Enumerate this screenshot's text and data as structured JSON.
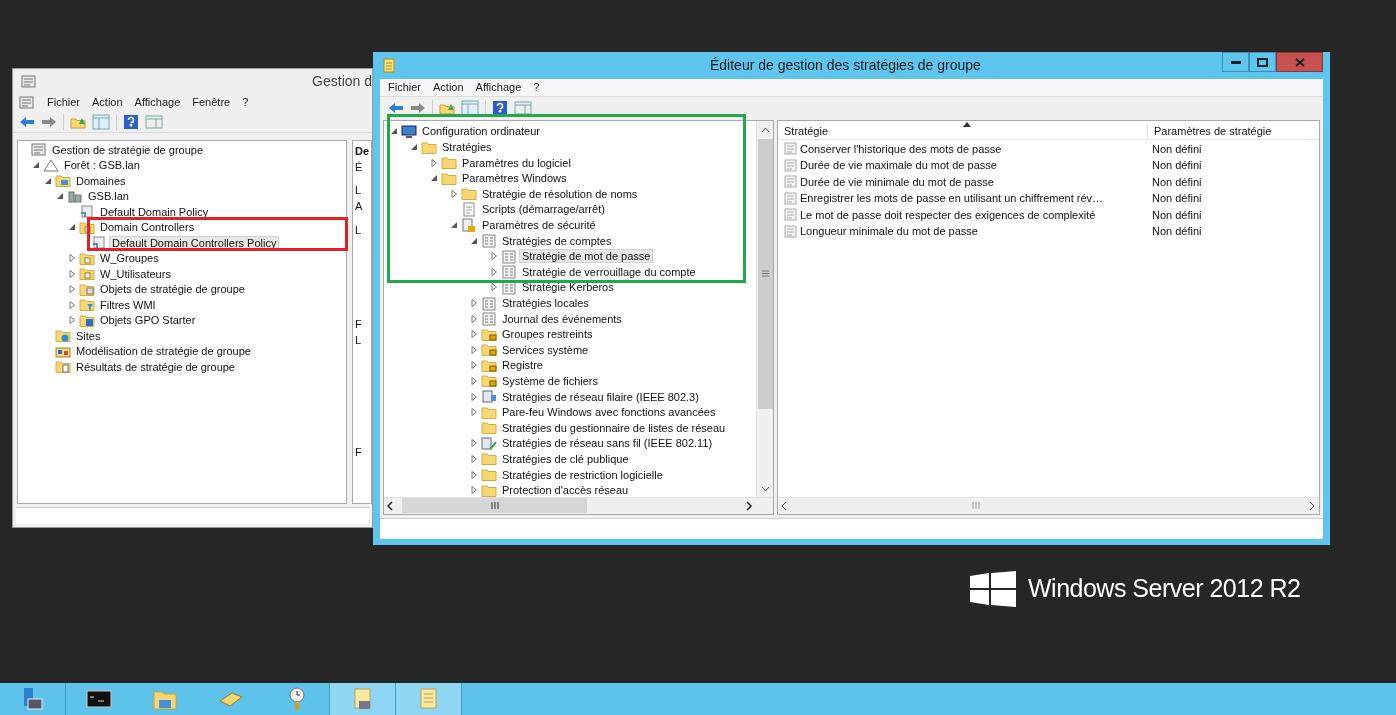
{
  "back_window": {
    "title": "Gestion d",
    "menu": [
      "Fichier",
      "Action",
      "Affichage",
      "Fenêtre",
      "?"
    ],
    "tree": [
      {
        "label": "Gestion de stratégie de groupe",
        "kind": "console",
        "selected": false,
        "children": [
          {
            "label": "Forêt : GSB.lan",
            "kind": "forest",
            "expanded": true,
            "selected": false,
            "children": [
              {
                "label": "Domaines",
                "kind": "domains",
                "expanded": true,
                "selected": false,
                "children": [
                  {
                    "label": "GSB.lan",
                    "kind": "domain",
                    "expanded": true,
                    "selected": false,
                    "children": [
                      {
                        "label": "Default Domain Policy",
                        "kind": "gpo",
                        "selected": false
                      },
                      {
                        "label": "Domain Controllers",
                        "kind": "ou",
                        "expanded": true,
                        "selected": false,
                        "children": [
                          {
                            "label": "Default Domain Controllers Policy",
                            "kind": "gpo",
                            "selected": true
                          }
                        ]
                      },
                      {
                        "label": "W_Groupes",
                        "kind": "ou",
                        "expanded": false,
                        "selected": false
                      },
                      {
                        "label": "W_Utilisateurs",
                        "kind": "ou",
                        "expanded": false,
                        "selected": false
                      },
                      {
                        "label": "Objets de stratégie de groupe",
                        "kind": "gpo-folder",
                        "expanded": false,
                        "selected": false
                      },
                      {
                        "label": "Filtres WMI",
                        "kind": "filter-folder",
                        "expanded": false,
                        "selected": false
                      },
                      {
                        "label": "Objets GPO Starter",
                        "kind": "starter-folder",
                        "expanded": false,
                        "selected": false
                      }
                    ]
                  }
                ]
              },
              {
                "label": "Sites",
                "kind": "sites",
                "selected": false
              },
              {
                "label": "Modélisation de stratégie de groupe",
                "kind": "modeling",
                "selected": false
              },
              {
                "label": "Résultats de stratégie de groupe",
                "kind": "results",
                "selected": false
              }
            ]
          }
        ]
      }
    ],
    "detail_pane": {
      "heading": "De",
      "fragments": [
        "É",
        "L",
        "A",
        "L",
        "F",
        "L",
        "F"
      ]
    }
  },
  "front_window": {
    "title": "Éditeur de gestion des stratégies de groupe",
    "menu": [
      "Fichier",
      "Action",
      "Affichage",
      "?"
    ],
    "tree": [
      {
        "label": "Configuration ordinateur",
        "kind": "computer",
        "expanded": true,
        "selected": false,
        "children": [
          {
            "label": "Stratégies",
            "kind": "folder",
            "expanded": true,
            "selected": false,
            "children": [
              {
                "label": "Paramètres du logiciel",
                "kind": "folder",
                "expanded": false,
                "selected": false
              },
              {
                "label": "Paramètres Windows",
                "kind": "folder",
                "expanded": true,
                "selected": false,
                "children": [
                  {
                    "label": "Stratégie de résolution de noms",
                    "kind": "folder",
                    "expanded": false,
                    "selected": false
                  },
                  {
                    "label": "Scripts (démarrage/arrêt)",
                    "kind": "script",
                    "selected": false
                  },
                  {
                    "label": "Paramètres de sécurité",
                    "kind": "security",
                    "expanded": true,
                    "selected": false,
                    "children": [
                      {
                        "label": "Stratégies de comptes",
                        "kind": "policy",
                        "expanded": true,
                        "selected": false,
                        "children": [
                          {
                            "label": "Stratégie de mot de passe",
                            "kind": "policy",
                            "expanded": false,
                            "selected": true
                          },
                          {
                            "label": "Stratégie de verrouillage du compte",
                            "kind": "policy",
                            "expanded": false,
                            "selected": false
                          },
                          {
                            "label": "Stratégie Kerberos",
                            "kind": "policy",
                            "expanded": false,
                            "selected": false
                          }
                        ]
                      },
                      {
                        "label": "Stratégies locales",
                        "kind": "policy",
                        "expanded": false,
                        "selected": false
                      },
                      {
                        "label": "Journal des événements",
                        "kind": "policy",
                        "expanded": false,
                        "selected": false
                      },
                      {
                        "label": "Groupes restreints",
                        "kind": "folder-lock",
                        "expanded": false,
                        "selected": false
                      },
                      {
                        "label": "Services système",
                        "kind": "folder-lock",
                        "expanded": false,
                        "selected": false
                      },
                      {
                        "label": "Registre",
                        "kind": "folder-lock",
                        "expanded": false,
                        "selected": false
                      },
                      {
                        "label": "Système de fichiers",
                        "kind": "folder-lock",
                        "expanded": false,
                        "selected": false
                      },
                      {
                        "label": "Stratégies de réseau filaire (IEEE 802.3)",
                        "kind": "wired",
                        "expanded": false,
                        "selected": false
                      },
                      {
                        "label": "Pare-feu Windows avec fonctions avancées",
                        "kind": "folder",
                        "expanded": false,
                        "selected": false
                      },
                      {
                        "label": "Stratégies du gestionnaire de listes de réseau",
                        "kind": "folder",
                        "selected": false
                      },
                      {
                        "label": "Stratégies de réseau sans fil (IEEE 802.11)",
                        "kind": "wireless",
                        "expanded": false,
                        "selected": false
                      },
                      {
                        "label": "Stratégies de clé publique",
                        "kind": "folder",
                        "expanded": false,
                        "selected": false
                      },
                      {
                        "label": "Stratégies de restriction logicielle",
                        "kind": "folder",
                        "expanded": false,
                        "selected": false
                      },
                      {
                        "label": "Protection d'accès réseau",
                        "kind": "folder",
                        "expanded": false,
                        "selected": false
                      }
                    ]
                  }
                ]
              }
            ]
          }
        ]
      }
    ],
    "list": {
      "columns": [
        {
          "label": "Stratégie",
          "sorted": true
        },
        {
          "label": "Paramètres de stratégie",
          "sorted": false
        }
      ],
      "rows": [
        [
          "Conserver l'historique des mots de passe",
          "Non défini"
        ],
        [
          "Durée de vie maximale du mot de passe",
          "Non défini"
        ],
        [
          "Durée de vie minimale du mot de passe",
          "Non défini"
        ],
        [
          "Enregistrer les mots de passe en utilisant un chiffrement rév…",
          "Non défini"
        ],
        [
          "Le mot de passe doit respecter des exigences de complexité",
          "Non défini"
        ],
        [
          "Longueur minimale du mot de passe",
          "Non défini"
        ]
      ]
    }
  },
  "annotations": [
    {
      "color": "#e3202b"
    },
    {
      "color": "#22a84a"
    }
  ],
  "desktop_branding": {
    "text": "Windows Server 2012 R2"
  },
  "taskbar": [
    {
      "kind": "server-manager",
      "active": false
    },
    {
      "kind": "command-prompt",
      "active": false
    },
    {
      "kind": "file-explorer",
      "active": false
    },
    {
      "kind": "drive",
      "active": false
    },
    {
      "kind": "task-scheduler",
      "active": false
    },
    {
      "kind": "gpmc",
      "active": true
    },
    {
      "kind": "gpedit",
      "active": true
    }
  ]
}
